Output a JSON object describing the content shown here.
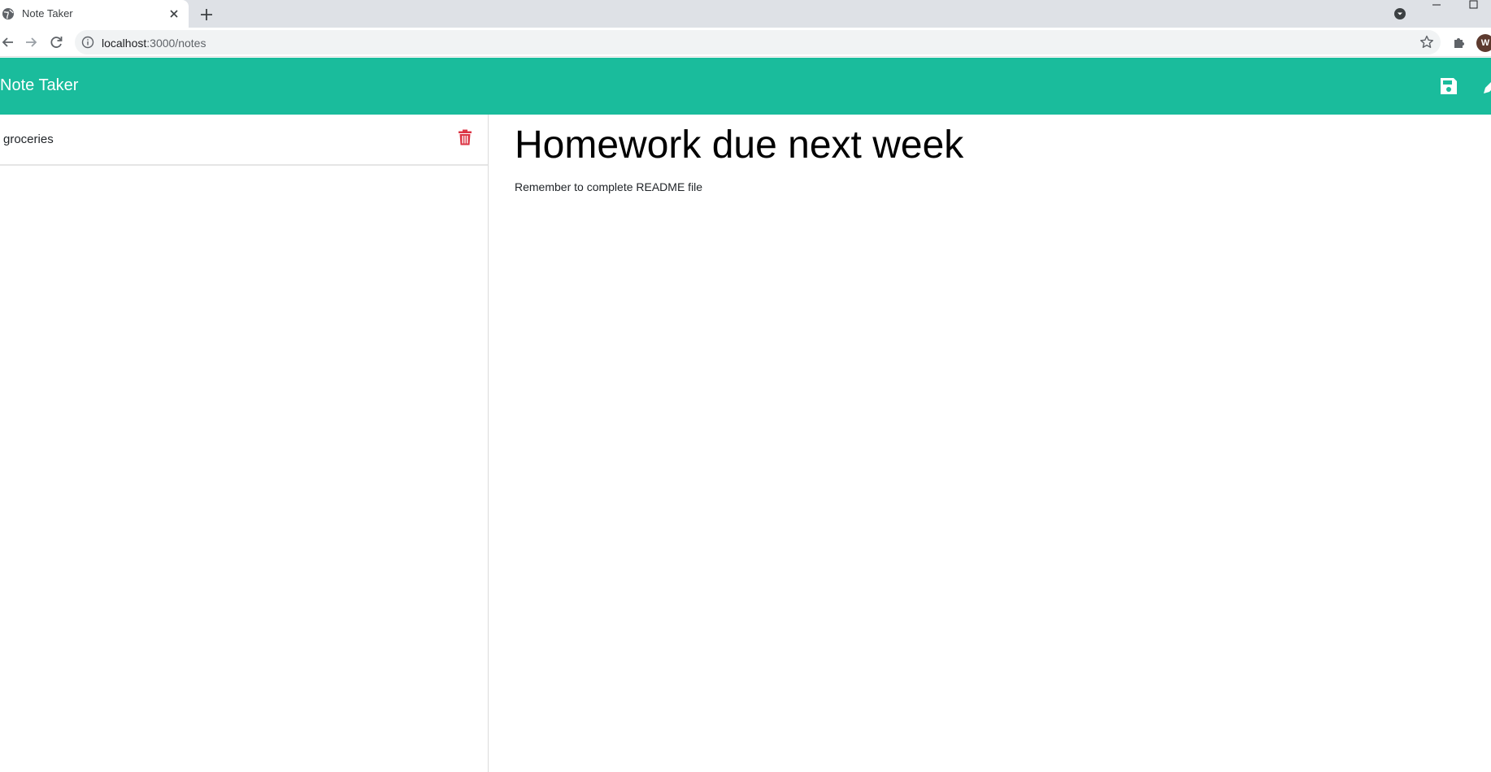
{
  "browser": {
    "tab_title": "Note Taker",
    "url_host": "localhost",
    "url_rest": ":3000/notes",
    "profile_initial": "W"
  },
  "app": {
    "brand": "Note Taker",
    "accent_color": "#1abc9c",
    "delete_color": "#dc3545"
  },
  "sidebar": {
    "notes": [
      {
        "title": "groceries"
      }
    ]
  },
  "active_note": {
    "title": "Homework due next week",
    "text": "Remember to complete README file"
  },
  "icons": [
    "globe-icon",
    "close-icon",
    "plus-icon",
    "chevron-down-icon",
    "back-icon",
    "forward-icon",
    "reload-icon",
    "info-icon",
    "star-icon",
    "puzzle-icon",
    "save-icon",
    "pen-icon",
    "trash-icon"
  ]
}
